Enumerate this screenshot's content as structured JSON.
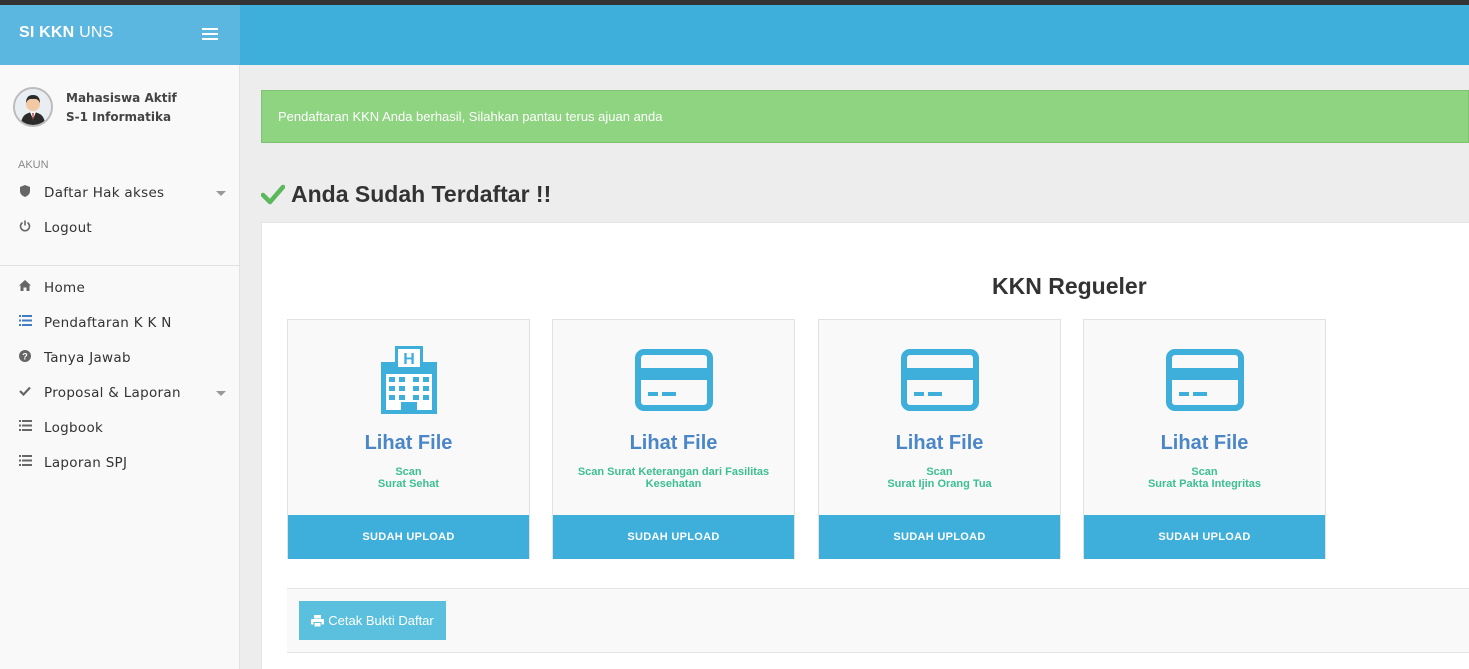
{
  "brand": {
    "bold": "SI KKN",
    "rest": "UNS"
  },
  "user": {
    "name": "Mahasiswa Aktif",
    "program": "S-1 Informatika"
  },
  "sidebar": {
    "section_label": "AKUN",
    "account_items": [
      {
        "label": "Daftar Hak akses",
        "icon": "shield-icon"
      },
      {
        "label": "Logout",
        "icon": "power-icon"
      }
    ],
    "nav_items": [
      {
        "label": "Home",
        "icon": "home-icon"
      },
      {
        "label": "Pendaftaran K K N",
        "icon": "list-icon"
      },
      {
        "label": "Tanya Jawab",
        "icon": "question-circle-icon"
      },
      {
        "label": "Proposal & Laporan",
        "icon": "check-icon"
      },
      {
        "label": "Logbook",
        "icon": "list-icon"
      },
      {
        "label": "Laporan SPJ",
        "icon": "list-icon"
      }
    ]
  },
  "alert": {
    "text": "Pendaftaran KKN Anda berhasil, Silahkan pantau terus ajuan anda"
  },
  "page": {
    "title": "Anda Sudah Terdaftar !!"
  },
  "panel": {
    "title": "KKN Regueler",
    "cards": [
      {
        "icon": "hospital-icon",
        "link": "Lihat File",
        "desc_line1": "Scan",
        "desc_line2": "Surat Sehat",
        "button": "SUDAH UPLOAD"
      },
      {
        "icon": "credit-card-icon",
        "link": "Lihat File",
        "desc_line1": "Scan Surat Keterangan dari Fasilitas",
        "desc_line2": "Kesehatan",
        "button": "SUDAH UPLOAD"
      },
      {
        "icon": "credit-card-icon",
        "link": "Lihat File",
        "desc_line1": "Scan",
        "desc_line2": "Surat Ijin Orang Tua",
        "button": "SUDAH UPLOAD"
      },
      {
        "icon": "credit-card-icon",
        "link": "Lihat File",
        "desc_line1": "Scan",
        "desc_line2": "Surat Pakta Integritas",
        "button": "SUDAH UPLOAD"
      }
    ],
    "print_button": "Cetak Bukti Daftar"
  },
  "colors": {
    "primary": "#3eaedb",
    "brand": "#5bb6e0",
    "alert": "#8ed481",
    "link": "#4a86c8",
    "desc": "#3cbf92",
    "check": "#5cb85c"
  }
}
